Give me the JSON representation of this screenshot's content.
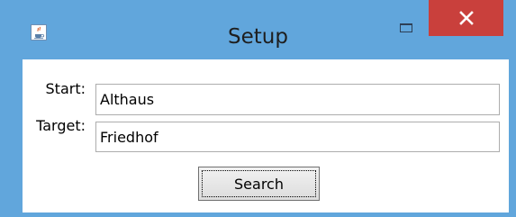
{
  "window": {
    "title": "Setup",
    "app_icon": "java-cup-icon",
    "controls": {
      "maximize_icon": "maximize-icon",
      "close_icon": "close-icon",
      "close_color": "#c9403c"
    },
    "frame_color": "#61a6dc"
  },
  "form": {
    "start": {
      "label": "Start:",
      "value": "Althaus"
    },
    "target": {
      "label": "Target:",
      "value": "Friedhof"
    },
    "search_button_label": "Search"
  }
}
